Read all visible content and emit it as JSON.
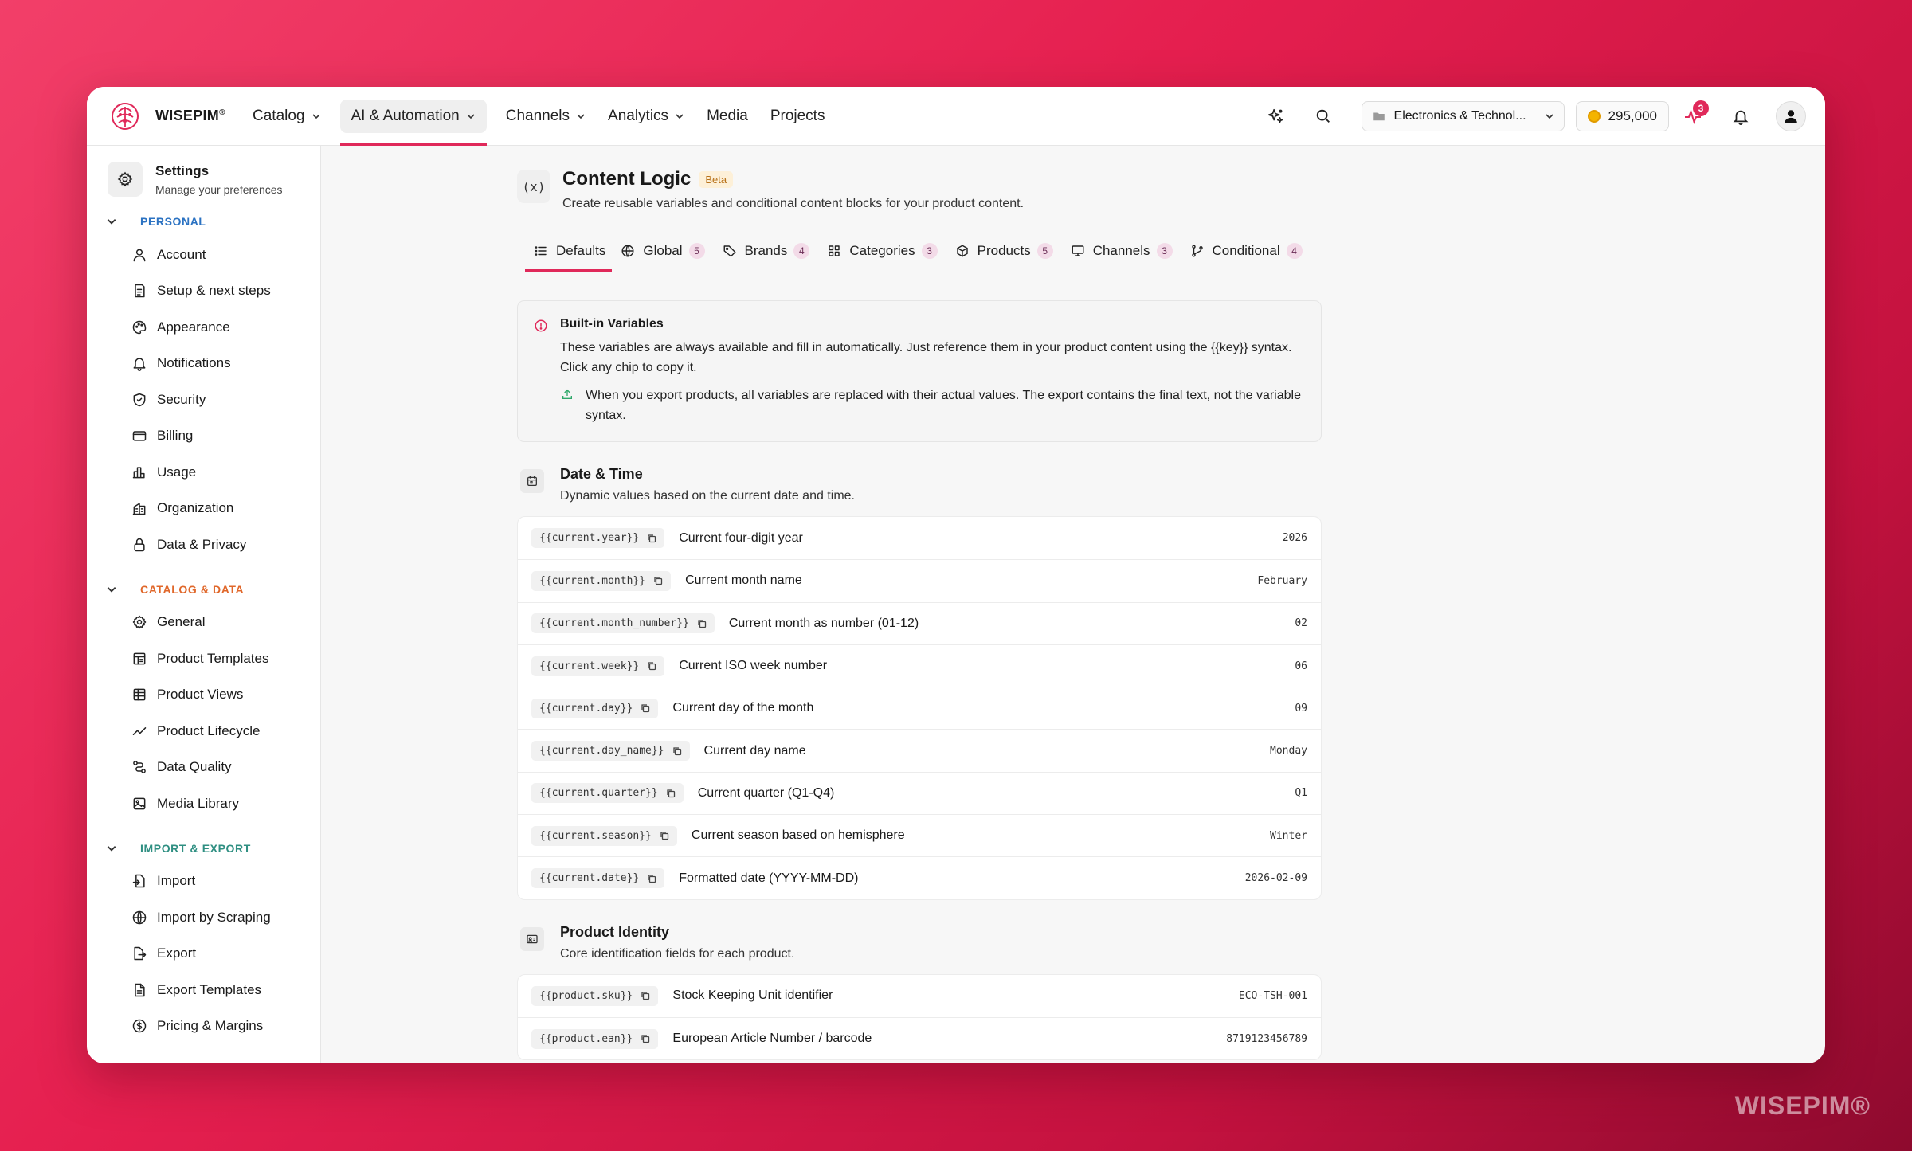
{
  "app": {
    "brand": "WISEPIM",
    "brand_mark": "®",
    "watermark": "WISEPIM®"
  },
  "nav": {
    "items": [
      {
        "label": "Catalog",
        "has_menu": true
      },
      {
        "label": "AI & Automation",
        "has_menu": true,
        "active": true
      },
      {
        "label": "Channels",
        "has_menu": true
      },
      {
        "label": "Analytics",
        "has_menu": true
      },
      {
        "label": "Media",
        "has_menu": false
      },
      {
        "label": "Projects",
        "has_menu": false
      }
    ]
  },
  "topbar": {
    "workspace": "Electronics & Technol...",
    "credits": "295,000",
    "activity_badge": "3",
    "icons": [
      "sparkles-icon",
      "search-icon",
      "activity-icon",
      "bell-icon",
      "user-avatar-icon"
    ]
  },
  "sidebar": {
    "title": "Settings",
    "subtitle": "Manage your preferences",
    "sections": [
      {
        "label": "PERSONAL",
        "color": "#2b72c2",
        "items": [
          "Account",
          "Setup & next steps",
          "Appearance",
          "Notifications",
          "Security",
          "Billing",
          "Usage",
          "Organization",
          "Data & Privacy"
        ]
      },
      {
        "label": "CATALOG & DATA",
        "color": "#e0672a",
        "items": [
          "General",
          "Product Templates",
          "Product Views",
          "Product Lifecycle",
          "Data Quality",
          "Media Library"
        ]
      },
      {
        "label": "IMPORT & EXPORT",
        "color": "#2f8f82",
        "items": [
          "Import",
          "Import by Scraping",
          "Export",
          "Export Templates",
          "Pricing & Margins"
        ]
      }
    ]
  },
  "page": {
    "icon_text": "(x)",
    "title": "Content Logic",
    "badge": "Beta",
    "subtitle": "Create reusable variables and conditional content blocks for your product content."
  },
  "tabs": [
    {
      "label": "Defaults",
      "count": null,
      "active": true
    },
    {
      "label": "Global",
      "count": "5"
    },
    {
      "label": "Brands",
      "count": "4"
    },
    {
      "label": "Categories",
      "count": "3"
    },
    {
      "label": "Products",
      "count": "5"
    },
    {
      "label": "Channels",
      "count": "3"
    },
    {
      "label": "Conditional",
      "count": "4"
    }
  ],
  "info": {
    "title": "Built-in Variables",
    "text": "These variables are always available and fill in automatically. Just reference them in your product content using the {{key}} syntax. Click any chip to copy it.",
    "export_note": "When you export products, all variables are replaced with their actual values. The export contains the final text, not the variable syntax."
  },
  "groups": [
    {
      "title": "Date & Time",
      "subtitle": "Dynamic values based on the current date and time.",
      "rows": [
        {
          "key": "{{current.year}}",
          "desc": "Current four-digit year",
          "value": "2026"
        },
        {
          "key": "{{current.month}}",
          "desc": "Current month name",
          "value": "February"
        },
        {
          "key": "{{current.month_number}}",
          "desc": "Current month as number (01-12)",
          "value": "02"
        },
        {
          "key": "{{current.week}}",
          "desc": "Current ISO week number",
          "value": "06"
        },
        {
          "key": "{{current.day}}",
          "desc": "Current day of the month",
          "value": "09"
        },
        {
          "key": "{{current.day_name}}",
          "desc": "Current day name",
          "value": "Monday"
        },
        {
          "key": "{{current.quarter}}",
          "desc": "Current quarter (Q1-Q4)",
          "value": "Q1"
        },
        {
          "key": "{{current.season}}",
          "desc": "Current season based on hemisphere",
          "value": "Winter"
        },
        {
          "key": "{{current.date}}",
          "desc": "Formatted date (YYYY-MM-DD)",
          "value": "2026-02-09"
        }
      ]
    },
    {
      "title": "Product Identity",
      "subtitle": "Core identification fields for each product.",
      "rows": [
        {
          "key": "{{product.sku}}",
          "desc": "Stock Keeping Unit identifier",
          "value": "ECO-TSH-001"
        },
        {
          "key": "{{product.ean}}",
          "desc": "European Article Number / barcode",
          "value": "8719123456789"
        }
      ]
    }
  ],
  "colors": {
    "accent": "#e0295a",
    "background_gradient_start": "#f23f69",
    "background_gradient_end": "#8e0a2e",
    "beta_badge": "#b8721a",
    "count_badge": "#f3dbe8"
  }
}
